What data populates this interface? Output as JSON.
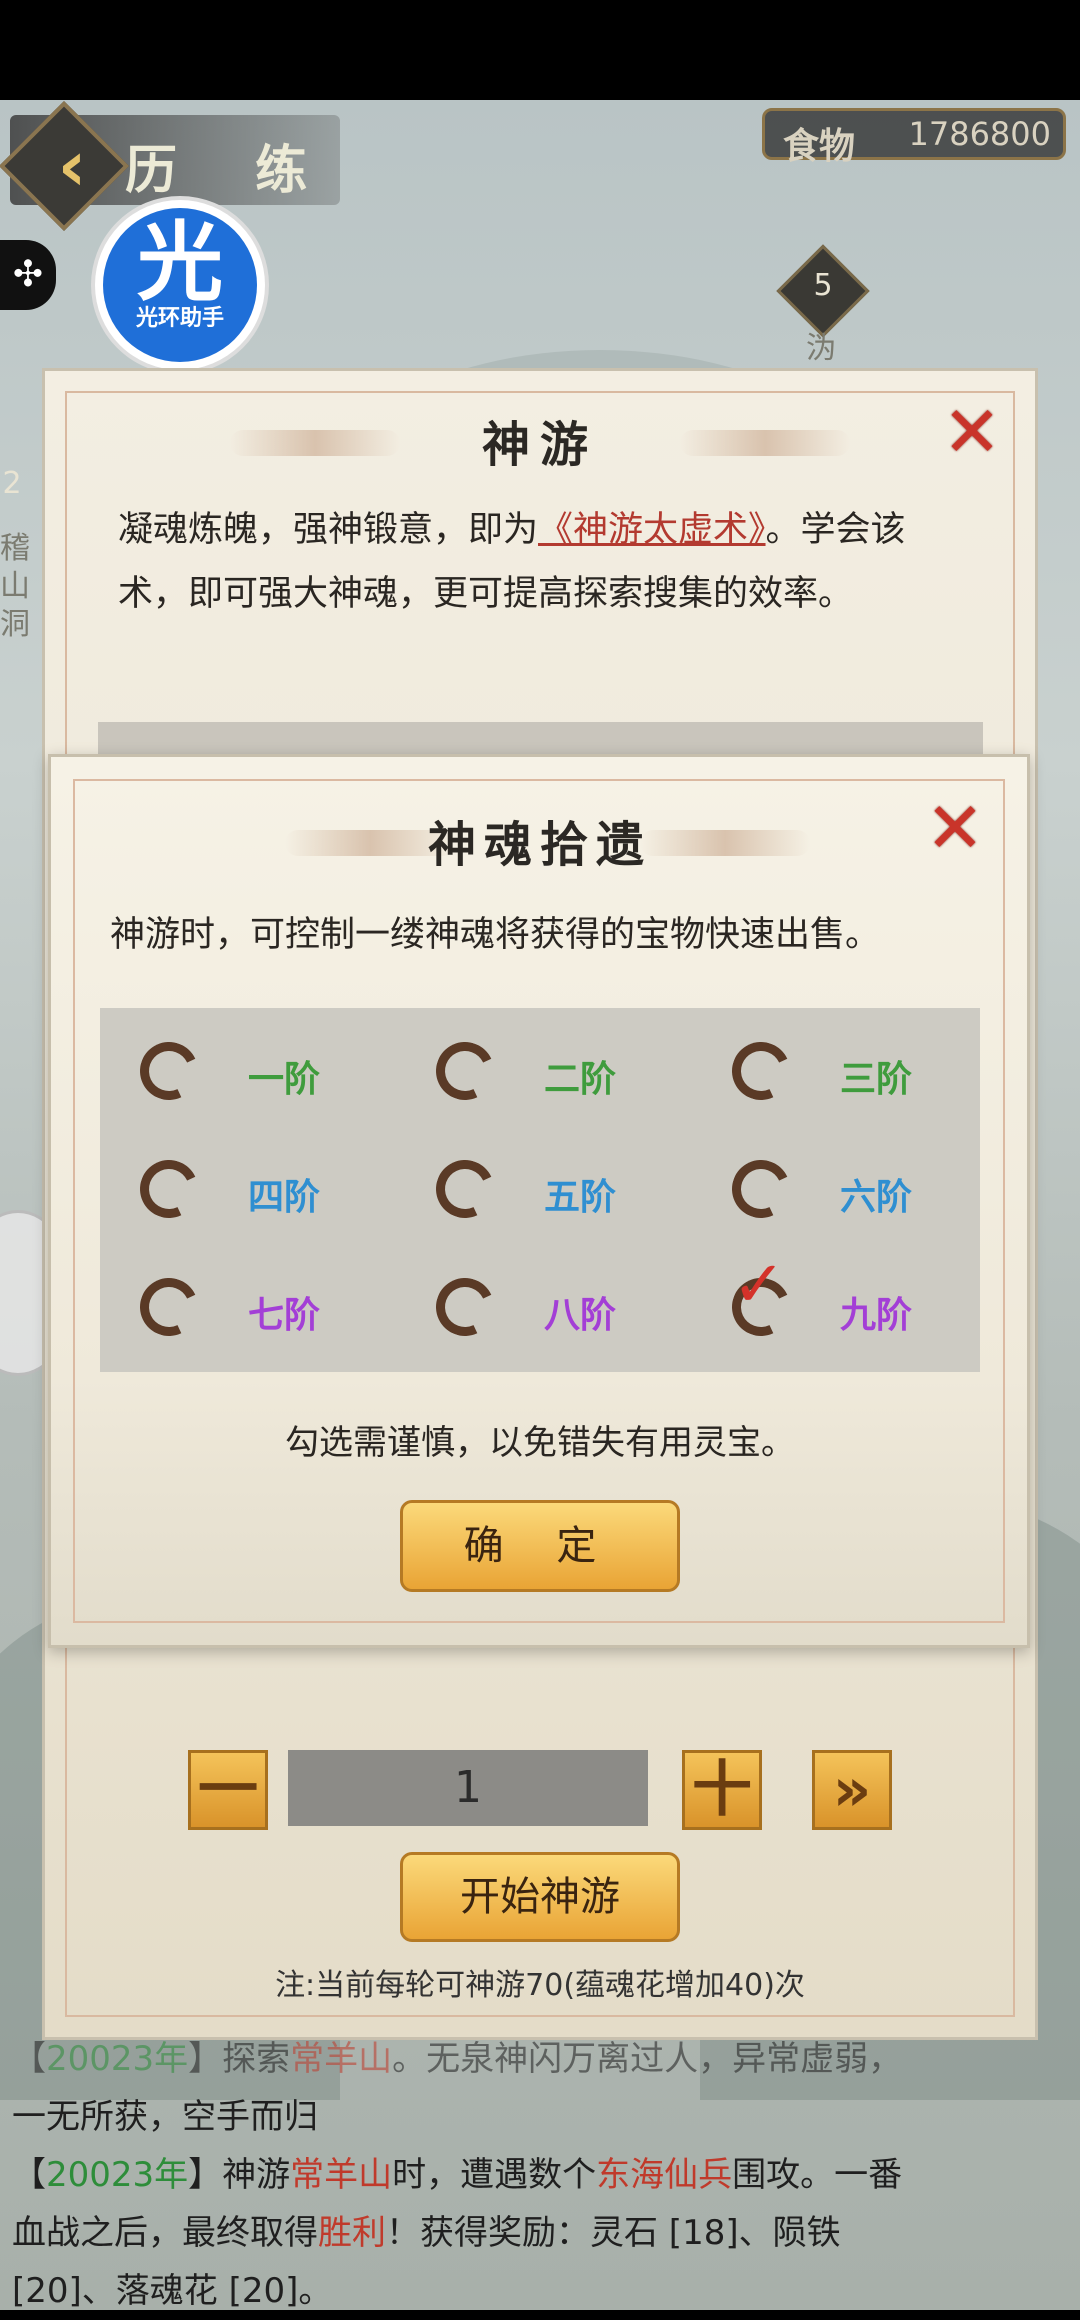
{
  "header": {
    "title": "历 练",
    "food_label": "食物",
    "food_value": "1786800"
  },
  "assistant_logo": {
    "char": "光",
    "sub": "光环助手"
  },
  "map_nodes": [
    {
      "num": "5",
      "label": "沩"
    },
    {
      "num": "2",
      "label": "稽山洞"
    }
  ],
  "main_dialog": {
    "title": "神游",
    "desc_pre": "凝魂炼魄，强神锻意，即为",
    "desc_link": "《神游太虚术》",
    "desc_post": "。学会该术，即可强大神魂，更可提高探索搜集的效率。",
    "quantity": "1",
    "minus": "一",
    "plus": "十",
    "max": "»",
    "start_label": "开始神游",
    "note": "注:当前每轮可神游70(蕴魂花增加40)次"
  },
  "log": {
    "line1": {
      "pre": "【",
      "year": "20023年",
      "mid": "】探索",
      "place": "常羊山",
      "post": "。无泉神闪万离过人，异常虚弱，"
    },
    "line2": "一无所获，空手而归",
    "line3": {
      "pre": "【",
      "year": "20023年",
      "mid": "】神游",
      "place": "常羊山",
      "mid2": "时，遭遇数个",
      "enemy": "东海仙兵",
      "post": "围攻。一番"
    },
    "line4": {
      "pre": "血战之后，最终取得",
      "win": "胜利",
      "post": "！获得奖励：灵石 [18]、陨铁"
    },
    "line5": "[20]、落魂花 [20]。"
  },
  "overlay_dialog": {
    "title": "神魂拾遗",
    "desc": "神游时，可控制一缕神魂将获得的宝物快速出售。",
    "tiers": [
      {
        "label": "一阶",
        "color": "#3f9c3d",
        "checked": false
      },
      {
        "label": "二阶",
        "color": "#3f9c3d",
        "checked": false
      },
      {
        "label": "三阶",
        "color": "#3f9c3d",
        "checked": false
      },
      {
        "label": "四阶",
        "color": "#2f8fd1",
        "checked": false
      },
      {
        "label": "五阶",
        "color": "#2f8fd1",
        "checked": false
      },
      {
        "label": "六阶",
        "color": "#2f8fd1",
        "checked": false
      },
      {
        "label": "七阶",
        "color": "#a33fd6",
        "checked": false
      },
      {
        "label": "八阶",
        "color": "#a33fd6",
        "checked": false
      },
      {
        "label": "九阶",
        "color": "#a33fd6",
        "checked": true
      }
    ],
    "warning": "勾选需谨慎，以免错失有用灵宝。",
    "confirm_label": "确 定"
  }
}
